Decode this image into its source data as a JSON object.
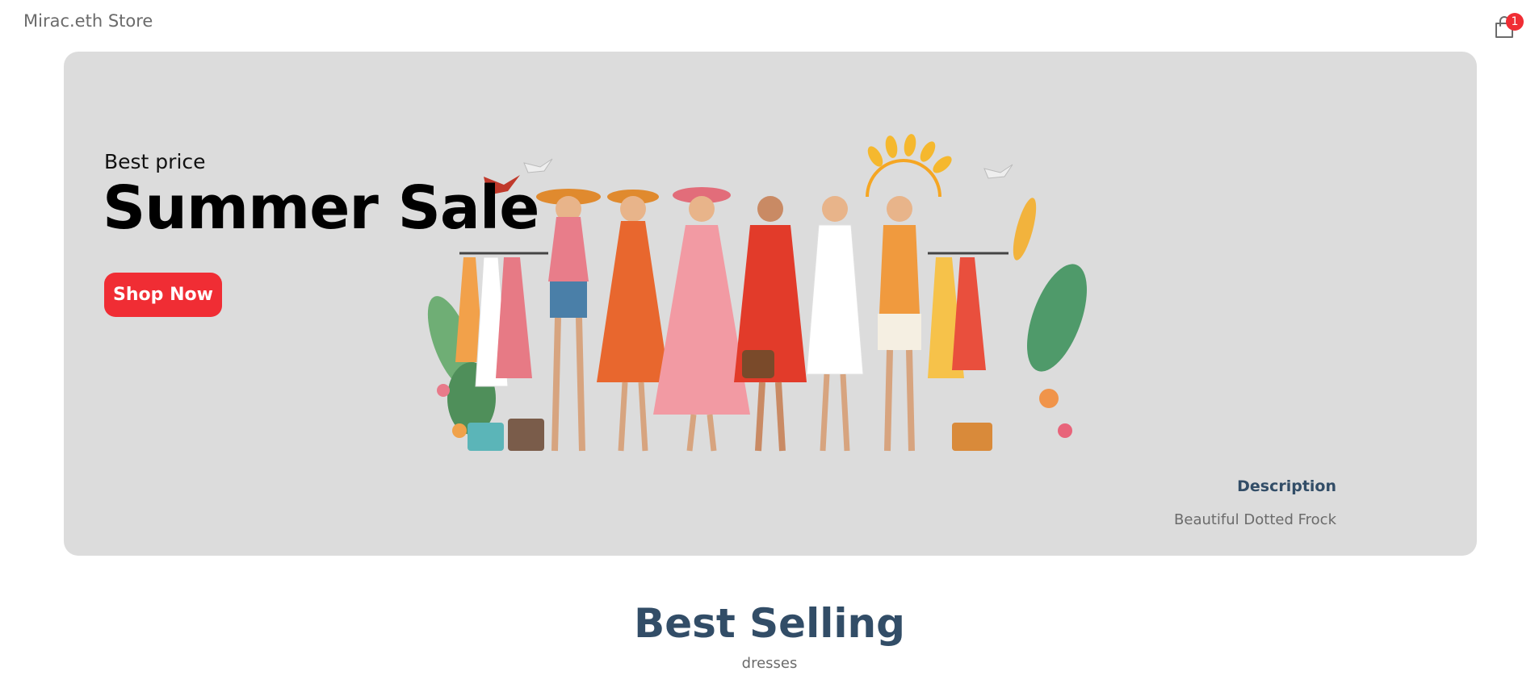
{
  "navbar": {
    "brand": "Mirac.eth Store",
    "cart_count": "1"
  },
  "hero": {
    "small_text": "Best price",
    "title": "Summer Sale",
    "button_label": "Shop Now",
    "description_title": "Description",
    "description_text": "Beautiful Dotted Frock"
  },
  "section": {
    "title": "Best Selling",
    "subtitle": "dresses"
  },
  "colors": {
    "accent": "#f02d34",
    "heading": "#324d67",
    "hero_bg": "#dcdcdc"
  },
  "icons": {
    "cart": "shopping-bag-icon"
  }
}
